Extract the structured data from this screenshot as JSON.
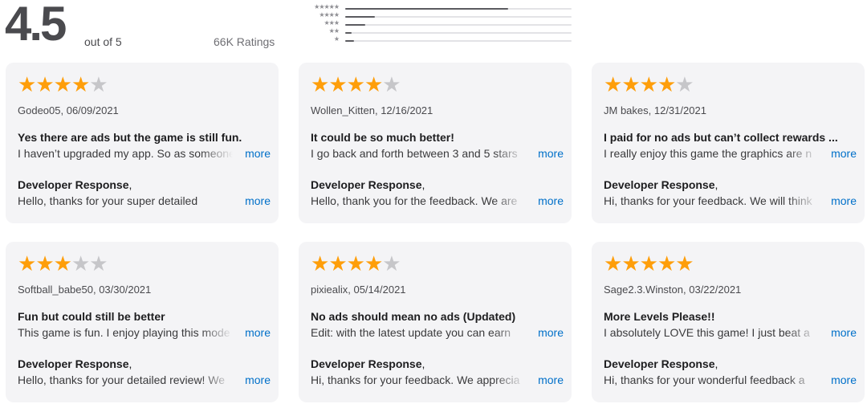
{
  "summary": {
    "rating": "4.5",
    "out_of": "out of 5",
    "ratings_count": "66K Ratings",
    "histogram": [
      {
        "stars": "★★★★★",
        "fraction": 0.72
      },
      {
        "stars": "★★★★",
        "fraction": 0.13
      },
      {
        "stars": "★★★",
        "fraction": 0.09
      },
      {
        "stars": "★★",
        "fraction": 0.03
      },
      {
        "stars": "★",
        "fraction": 0.04
      }
    ]
  },
  "more_label": "more",
  "developer_response_label": "Developer Response",
  "reviews": [
    {
      "rating": 4,
      "author": "Godeo05, 06/09/2021",
      "title": "Yes there are ads but the game is still fun.",
      "body": "I haven’t upgraded my app. So as someone",
      "dev_response": "Hello, thanks for your super detailed"
    },
    {
      "rating": 4,
      "author": "Wollen_Kitten, 12/16/2021",
      "title": "It could be so much better!",
      "body": "I go back and forth between 3 and 5 stars",
      "dev_response": "Hello, thank you for the feedback. We are"
    },
    {
      "rating": 4,
      "author": "JM bakes, 12/31/2021",
      "title": "I paid for no ads but can’t collect rewards ...",
      "body": "I really enjoy this game the graphics are n",
      "dev_response": "Hi, thanks for your feedback. We will think"
    },
    {
      "rating": 3,
      "author": "Softball_babe50, 03/30/2021",
      "title": "Fun but could still be better",
      "body": "This game is fun. I enjoy playing this mode",
      "dev_response": "Hello, thanks for your detailed review! We"
    },
    {
      "rating": 4,
      "author": "pixiealix, 05/14/2021",
      "title": "No ads should mean no ads (Updated)",
      "body": "Edit: with the latest update you can earn",
      "dev_response": "Hi, thanks for your feedback. We apprecia"
    },
    {
      "rating": 5,
      "author": "Sage2.3.Winston, 03/22/2021",
      "title": "More Levels Please!!",
      "body": "I absolutely LOVE this game! I just beat a",
      "dev_response": "Hi, thanks for your wonderful feedback a"
    }
  ]
}
